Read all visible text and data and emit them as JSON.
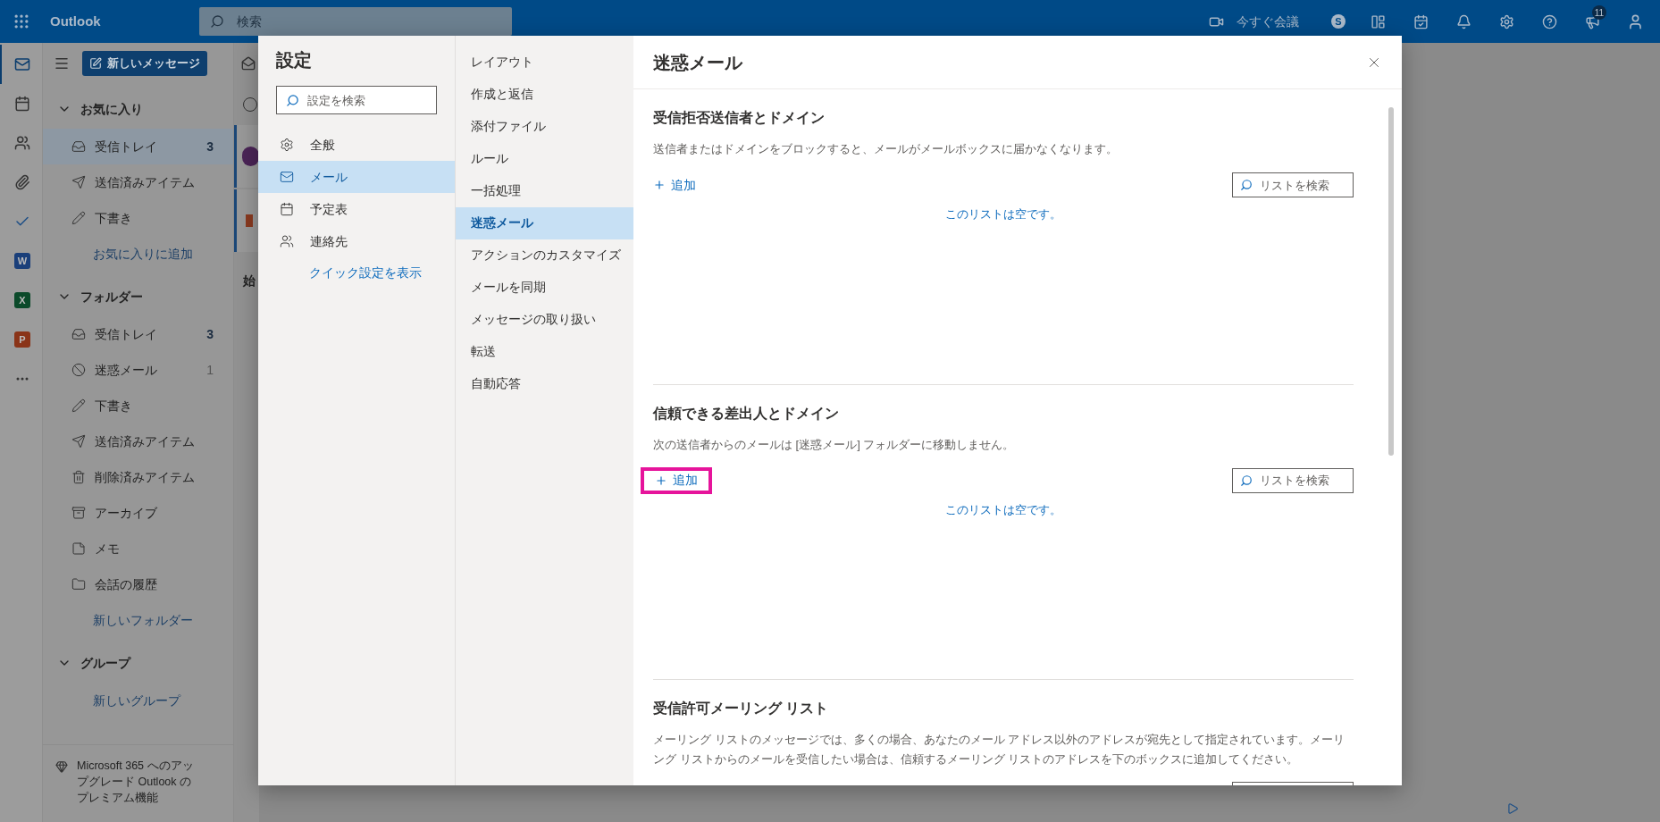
{
  "top_bar": {
    "app_name": "Outlook",
    "search": {
      "placeholder": "検索"
    },
    "meet_now": "今すぐ会議",
    "skype_glyph": "S",
    "notification_badge": "11"
  },
  "rail_items": [
    {
      "kind": "mail",
      "selected": true
    },
    {
      "kind": "calendar",
      "selected": false
    },
    {
      "kind": "people",
      "selected": false
    },
    {
      "kind": "files",
      "selected": false
    },
    {
      "kind": "todo",
      "selected": false
    },
    {
      "kind": "word",
      "glyph": "W",
      "selected": false
    },
    {
      "kind": "excel",
      "glyph": "X",
      "selected": false
    },
    {
      "kind": "powerpoint",
      "glyph": "P",
      "selected": false
    },
    {
      "kind": "more",
      "selected": false
    }
  ],
  "sidebar": {
    "new_message": "新しいメッセージ",
    "sections": [
      {
        "title": "お気に入り",
        "expanded": true,
        "items": [
          {
            "kind": "inbox",
            "label": "受信トレイ",
            "count": "3",
            "bold_count": true,
            "selected": true
          },
          {
            "kind": "sent",
            "label": "送信済みアイテム",
            "selected": false
          },
          {
            "kind": "drafts",
            "label": "下書き",
            "selected": false
          }
        ],
        "add_link": "お気に入りに追加"
      },
      {
        "title": "フォルダー",
        "expanded": true,
        "items": [
          {
            "kind": "inbox",
            "label": "受信トレイ",
            "count": "3",
            "bold_count": true,
            "selected": false
          },
          {
            "kind": "junk",
            "label": "迷惑メール",
            "count": "1",
            "bold_count": false,
            "selected": false
          },
          {
            "kind": "drafts",
            "label": "下書き",
            "selected": false
          },
          {
            "kind": "sent",
            "label": "送信済みアイテム",
            "selected": false
          },
          {
            "kind": "deleted",
            "label": "削除済みアイテム",
            "selected": false
          },
          {
            "kind": "archive",
            "label": "アーカイブ",
            "selected": false
          },
          {
            "kind": "notes",
            "label": "メモ",
            "selected": false
          },
          {
            "kind": "folder",
            "label": "会話の履歴",
            "selected": false
          }
        ],
        "add_link": "新しいフォルダー"
      },
      {
        "title": "グループ",
        "expanded": true,
        "add_link": "新しいグループ"
      }
    ],
    "promo": "Microsoft 365 へのアップグレード Outlook のプレミアム機能"
  },
  "message_list": {
    "heading": "始"
  },
  "settings": {
    "title": "設定",
    "search": {
      "placeholder": "設定を検索"
    },
    "categories": [
      {
        "kind": "general",
        "label": "全般",
        "selected": false
      },
      {
        "kind": "mail",
        "label": "メール",
        "selected": true
      },
      {
        "kind": "calendar",
        "label": "予定表",
        "selected": false
      },
      {
        "kind": "people",
        "label": "連絡先",
        "selected": false
      }
    ],
    "quick_settings_link": "クイック設定を表示",
    "subcategories": [
      {
        "label": "レイアウト",
        "selected": false
      },
      {
        "label": "作成と返信",
        "selected": false
      },
      {
        "label": "添付ファイル",
        "selected": false
      },
      {
        "label": "ルール",
        "selected": false
      },
      {
        "label": "一括処理",
        "selected": false
      },
      {
        "label": "迷惑メール",
        "selected": true
      },
      {
        "label": "アクションのカスタマイズ",
        "selected": false
      },
      {
        "label": "メールを同期",
        "selected": false
      },
      {
        "label": "メッセージの取り扱い",
        "selected": false
      },
      {
        "label": "転送",
        "selected": false
      },
      {
        "label": "自動応答",
        "selected": false
      }
    ],
    "panel": {
      "title": "迷惑メール",
      "sections": [
        {
          "kind": "list",
          "title": "受信拒否送信者とドメイン",
          "description": "送信者またはドメインをブロックすると、メールがメールボックスに届かなくなります。",
          "add_button": {
            "label": "追加",
            "highlighted": false
          },
          "search": {
            "placeholder": "リストを検索"
          },
          "empty_text": "このリストは空です。"
        },
        {
          "kind": "list",
          "title": "信頼できる差出人とドメイン",
          "description": "次の送信者からのメールは [迷惑メール] フォルダーに移動しません。",
          "add_button": {
            "label": "追加",
            "highlighted": true
          },
          "search": {
            "placeholder": "リストを検索"
          },
          "empty_text": "このリストは空です。"
        },
        {
          "kind": "list",
          "title": "受信許可メーリング リスト",
          "description": "メーリング リストのメッセージでは、多くの場合、あなたのメール アドレス以外のアドレスが宛先として指定されています。メーリング リストからのメールを受信したい場合は、信頼するメーリング リストのアドレスを下のボックスに追加してください。"
        }
      ]
    }
  }
}
